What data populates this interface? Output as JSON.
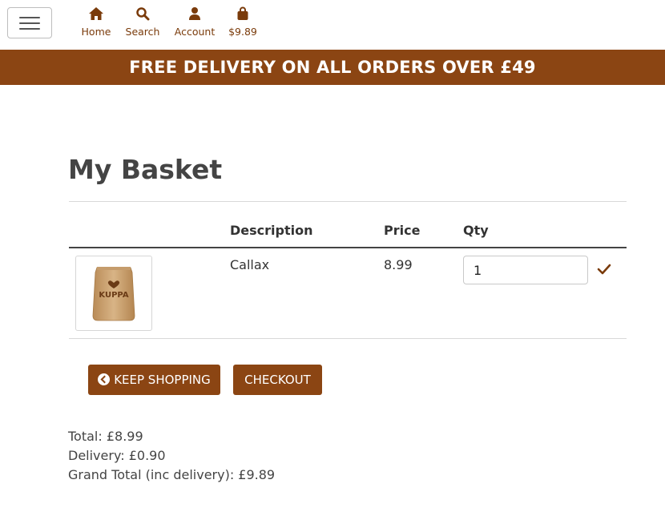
{
  "nav": {
    "items": [
      {
        "label": "Home",
        "icon": "home-icon"
      },
      {
        "label": "Search",
        "icon": "search-icon"
      },
      {
        "label": "Account",
        "icon": "user-icon"
      },
      {
        "label": "$9.89",
        "icon": "shopping-bag-icon"
      }
    ]
  },
  "banner": {
    "text": "FREE DELIVERY ON ALL ORDERS OVER £49"
  },
  "basket": {
    "title": "My Basket",
    "columns": [
      "Description",
      "Price",
      "Qty"
    ],
    "items": [
      {
        "description": "Callax",
        "price": "8.99",
        "qty": "1",
        "image_label": "KUPPA"
      }
    ]
  },
  "actions": {
    "keep_shopping": "KEEP SHOPPING",
    "checkout": "CHECKOUT"
  },
  "summary": {
    "total": "Total: £8.99",
    "delivery": "Delivery: £0.90",
    "grand_total": "Grand Total (inc delivery): £9.89"
  },
  "colors": {
    "brand": "#8b4513",
    "text": "#3b3b3b"
  }
}
